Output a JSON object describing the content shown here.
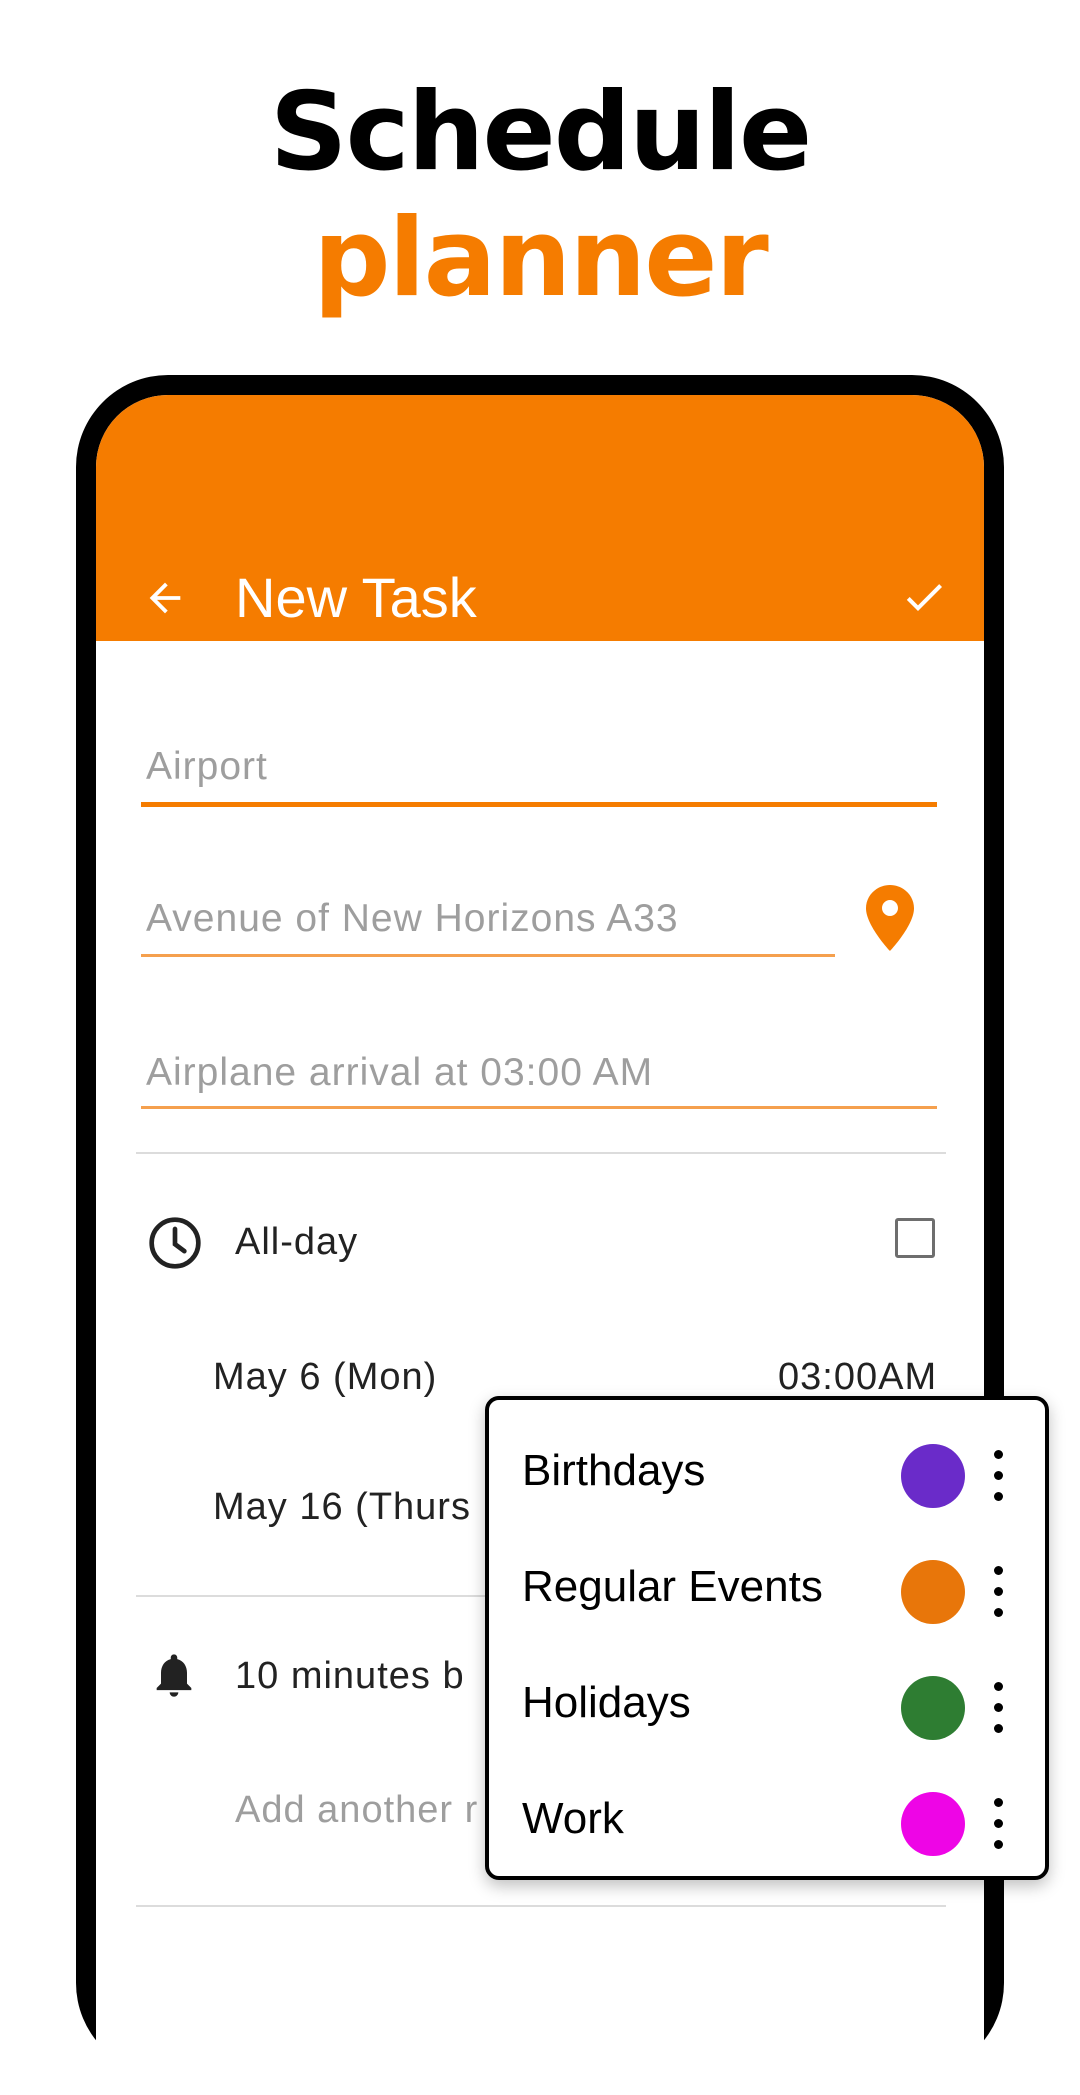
{
  "headline": {
    "line1": "Schedule",
    "line2": "planner"
  },
  "colors": {
    "accent": "#f57c00"
  },
  "appbar": {
    "title": "New Task",
    "back_icon": "arrow-left-icon",
    "confirm_icon": "check-icon"
  },
  "form": {
    "title_field": {
      "placeholder": "Airport"
    },
    "location_field": {
      "placeholder": "Avenue of New Horizons A33",
      "icon": "location-pin-icon"
    },
    "description_field": {
      "placeholder": "Airplane arrival at 03:00 AM"
    },
    "all_day": {
      "label": "All-day",
      "checked": false
    },
    "start": {
      "date": "May 6 (Mon)",
      "time": "03:00AM"
    },
    "end": {
      "date": "May 16 (Thurs"
    },
    "reminder": {
      "label": "10 minutes b"
    },
    "add_reminder": {
      "label": "Add another r"
    }
  },
  "calendar_menu": {
    "items": [
      {
        "name": "Birthdays",
        "color": "#6a2bc9"
      },
      {
        "name": "Regular Events",
        "color": "#e8760a"
      },
      {
        "name": "Holidays",
        "color": "#2e7d32"
      },
      {
        "name": "Work",
        "color": "#ee05e6"
      }
    ]
  }
}
